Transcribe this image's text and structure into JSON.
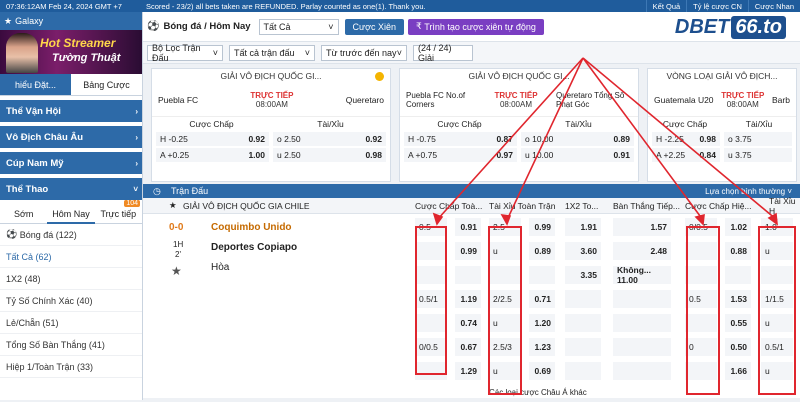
{
  "topbar": {
    "time": "07:36:12AM Feb 24, 2024 GMT +7",
    "notice": "Scored - 23/2) all bets taken are REFUNDED. Parlay counted as one(1). Thank you.",
    "ket_qua": "Kết Quả",
    "ty_le": "Tỷ lệ cược CN",
    "nhac": "Cược Nhan"
  },
  "left": {
    "galaxy": "Galaxy",
    "banner_l1": "Hot Streamer",
    "banner_l2": "Tường Thuật",
    "tabs": [
      "hiểu Đặt...",
      "Bảng Cược"
    ],
    "sections": [
      "Thể Vận Hội",
      "Vô Địch Châu Âu",
      "Cúp Nam Mỹ",
      "Thể Thao"
    ],
    "subtabs": [
      "Sớm",
      "Hôm Nay",
      "Trực tiếp"
    ],
    "badge": "104",
    "items": [
      "Bóng đá (122)",
      "Tất Cả (62)",
      "1X2 (48)",
      "Tỷ Số Chính Xác (40)",
      "Lẻ/Chẵn (51)",
      "Tổng Số Bàn Thắng (41)",
      "Hiệp 1/Toàn Trận (33)"
    ]
  },
  "header": {
    "breadcrumb": "Bóng đá / Hôm Nay",
    "select": "Tất Cả",
    "cuoc_xien": "Cược Xiên",
    "trinh_tao": "Trình tạo cược xiên tự động",
    "logo_a": "D",
    "logo_b": "BET",
    "logo_num": "66.to"
  },
  "filters": {
    "f1": "Bộ Lọc Trận Đấu",
    "f2": "Tất cả trận đấu",
    "f3": "Từ trước đến nay",
    "count": "(24 / 24) Giải"
  },
  "cards": [
    {
      "league": "GIẢI VÔ ĐỊCH QUỐC GI...",
      "home": "Puebla FC",
      "away": "Queretaro",
      "live": "TRỰC TIẾP",
      "time": "08:00AM",
      "h1": "Cược Chấp",
      "h2": "Tài/Xỉu",
      "r1": [
        "H -0.25",
        "0.92",
        "o 2.50",
        "0.92"
      ],
      "r2": [
        "A +0.25",
        "1.00",
        "u 2.50",
        "0.98"
      ]
    },
    {
      "league": "GIẢI VÔ ĐỊCH QUỐC GI...",
      "home": "Puebla FC No.of Corners",
      "away": "Queretaro Tổng Số Phạt Góc",
      "live": "TRỰC TIẾP",
      "time": "08:00AM",
      "h1": "Cược Chấp",
      "h2": "Tài/Xỉu",
      "r1": [
        "H -0.75",
        "0.87",
        "o 10.00",
        "0.89"
      ],
      "r2": [
        "A +0.75",
        "0.97",
        "u 10.00",
        "0.91"
      ]
    },
    {
      "league": "VÒNG LOẠI GIẢI VÔ ĐỊCH...",
      "home": "Guatemala U20",
      "away": "Barb",
      "live": "TRỰC TIẾP",
      "time": "08:00AM",
      "h1": "Cược Chấp",
      "h2": "Tài/Xỉu",
      "r1": [
        "H -2.25",
        "0.98",
        "o 3.75",
        ""
      ],
      "r2": [
        "A +2.25",
        "0.84",
        "u 3.75",
        ""
      ]
    }
  ],
  "table": {
    "title": "Trận Đấu",
    "select": "Lựa chọn bình thường",
    "league": "GIẢI VÔ ĐỊCH QUỐC GIA CHILE",
    "cols": [
      "Cược Chấp Toà...",
      "Tài Xỉu Toàn Trận",
      "1X2 To...",
      "Bàn Thắng Tiếp...",
      "Cược Chấp Hiệ...",
      "Tài Xỉu H"
    ],
    "score": "0-0",
    "half": "1H",
    "minute": "2'",
    "home": "Coquimbo Unido",
    "away": "Deportes Copiapo",
    "draw": "Hòa",
    "footer": "Các loại cược Châu Á khác",
    "rows": [
      [
        "0.5",
        "0.91",
        "2.5",
        "0.99",
        "1.91",
        "1.57",
        "0/0.5",
        "1.02",
        "1.0",
        ""
      ],
      [
        "",
        "0.99",
        "u",
        "0.89",
        "3.60",
        "2.48",
        "",
        "0.88",
        "u",
        ""
      ],
      [
        "",
        "",
        "",
        "",
        "3.35",
        "Không... 11.00",
        "",
        "",
        "",
        ""
      ],
      [
        "0.5/1",
        "1.19",
        "2/2.5",
        "0.71",
        "",
        "",
        "0.5",
        "1.53",
        "1/1.5",
        ""
      ],
      [
        "",
        "0.74",
        "u",
        "1.20",
        "",
        "",
        "",
        "0.55",
        "u",
        ""
      ],
      [
        "0/0.5",
        "0.67",
        "2.5/3",
        "1.23",
        "",
        "",
        "0",
        "0.50",
        "0.5/1",
        ""
      ],
      [
        "",
        "1.29",
        "u",
        "0.69",
        "",
        "",
        "",
        "1.66",
        "u",
        ""
      ]
    ]
  },
  "colors": {
    "accent": "#2d6aa8",
    "highlight": "#e0262e",
    "live": "#d33"
  }
}
